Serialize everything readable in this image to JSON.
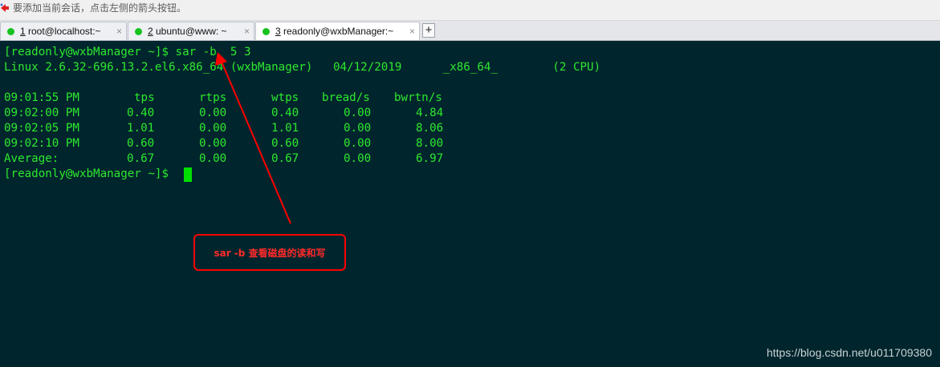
{
  "hint_bar": {
    "text": "要添加当前会话，点击左侧的箭头按钮。",
    "arrow_icon": "red-left-arrow-icon"
  },
  "tabs": [
    {
      "number": "1",
      "title": "root@localhost:~",
      "status_color": "#17c21e",
      "active": false
    },
    {
      "number": "2",
      "title": "ubuntu@www: ~",
      "status_color": "#17c21e",
      "active": false
    },
    {
      "number": "3",
      "title": "readonly@wxbManager:~",
      "status_color": "#17c21e",
      "active": true
    }
  ],
  "tab_add_label": "+",
  "tab_close_label": "×",
  "terminal": {
    "prompt_command": "[readonly@wxbManager ~]$ sar -b  5 3",
    "system_line": "Linux 2.6.32-696.13.2.el6.x86_64 (wxbManager)   04/12/2019      _x86_64_        (2 CPU)",
    "table": {
      "headers": [
        "09:01:55 PM",
        "tps",
        "rtps",
        "wtps",
        "bread/s",
        "bwrtn/s"
      ],
      "rows": [
        [
          "09:02:00 PM",
          "0.40",
          "0.00",
          "0.40",
          "0.00",
          "4.84"
        ],
        [
          "09:02:05 PM",
          "1.01",
          "0.00",
          "1.01",
          "0.00",
          "8.06"
        ],
        [
          "09:02:10 PM",
          "0.60",
          "0.00",
          "0.60",
          "0.00",
          "8.00"
        ],
        [
          "Average:",
          "0.67",
          "0.00",
          "0.67",
          "0.00",
          "6.97"
        ]
      ]
    },
    "final_prompt": "[readonly@wxbManager ~]$ ",
    "text_color": "#2ee82e",
    "background_color": "#00252d"
  },
  "annotation": {
    "text": "sar -b 查看磁盘的读和写",
    "color": "#ff0000"
  },
  "watermark": "https://blog.csdn.net/u011709380"
}
